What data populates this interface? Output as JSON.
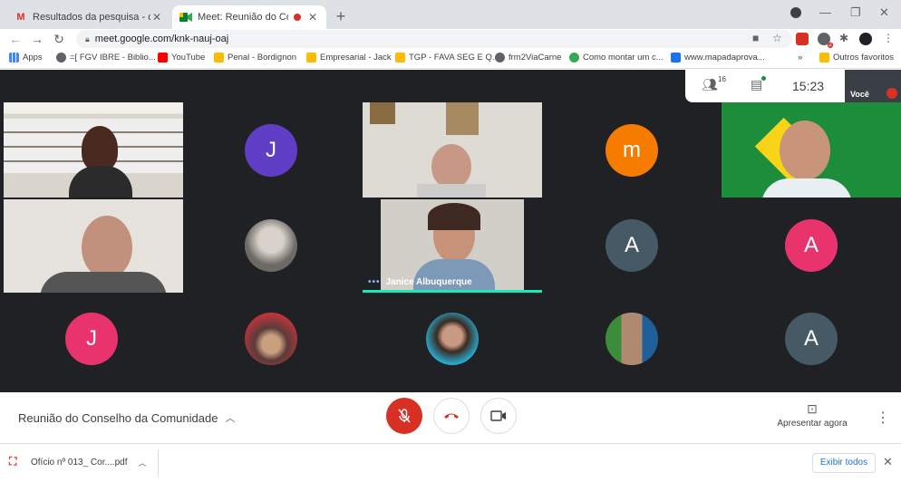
{
  "browser": {
    "tabs": [
      {
        "title": "Resultados da pesquisa - conseli",
        "favicon": "gmail-icon",
        "active": false
      },
      {
        "title": "Meet: Reunião do Conselho",
        "favicon": "meet-icon",
        "active": true,
        "recording": true
      }
    ],
    "new_tab": "+",
    "url": "meet.google.com/knk-nauj-oaj",
    "extension_badge": "2"
  },
  "bookmarks": {
    "apps_label": "Apps",
    "items": [
      {
        "label": "=[ FGV IBRE - Biblio...",
        "color": "#5f6368"
      },
      {
        "label": "YouTube",
        "color": "#ff0000"
      },
      {
        "label": "Penal - Bordignon",
        "color": "#fbbc04"
      },
      {
        "label": "Empresarial - Jack",
        "color": "#fbbc04"
      },
      {
        "label": "TGP - FAVA SEG E Q...",
        "color": "#fbbc04"
      },
      {
        "label": "frm2ViaCarne",
        "color": "#5f6368"
      },
      {
        "label": "Como montar um c...",
        "color": "#34a853"
      },
      {
        "label": "www.mapadaprova...",
        "color": "#1a73e8"
      }
    ],
    "overflow": "»",
    "other_label": "Outros favoritos"
  },
  "meet": {
    "participants_count": "16",
    "time": "15:23",
    "self_label": "Você",
    "speaker_name": "Janice Albuquerque",
    "avatars": [
      {
        "letter": "J",
        "color": "#5f3dc4"
      },
      {
        "letter": "m",
        "color": "#f57c00"
      },
      {
        "letter": "A",
        "color": "#455a64"
      },
      {
        "letter": "A",
        "color": "#e8336d"
      },
      {
        "letter": "J",
        "color": "#e8336d"
      },
      {
        "letter": "A",
        "color": "#455a64"
      }
    ],
    "meeting_name": "Reunião do Conselho da Comunidade",
    "present_label": "Apresentar agora",
    "colors": {
      "end_call": "#d93025",
      "mic_off": "#d93025",
      "speaking": "#1de9b6"
    }
  },
  "downloads": {
    "file": "Ofício nº 013_ Cor....pdf",
    "show_all": "Exibir todos"
  }
}
